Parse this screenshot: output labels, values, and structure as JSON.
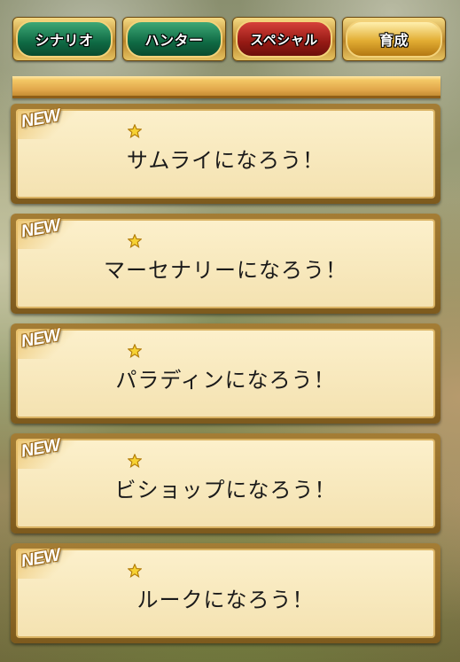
{
  "tabs": [
    {
      "label": "シナリオ",
      "color": "#0f6a44"
    },
    {
      "label": "ハンター",
      "color": "#0f6a44"
    },
    {
      "label": "スペシャル",
      "color": "#951a14"
    },
    {
      "label": "育成",
      "color": "#e2ad33",
      "selected": true
    }
  ],
  "missions": [
    {
      "badge": "NEW",
      "title": "サムライになろう！",
      "icon": "star-icon"
    },
    {
      "badge": "NEW",
      "title": "マーセナリーになろう！",
      "icon": "star-icon"
    },
    {
      "badge": "NEW",
      "title": "パラディンになろう！",
      "icon": "star-icon"
    },
    {
      "badge": "NEW",
      "title": "ビショップになろう！",
      "icon": "star-icon"
    },
    {
      "badge": "NEW",
      "title": "ルークになろう！",
      "icon": "star-icon"
    }
  ]
}
